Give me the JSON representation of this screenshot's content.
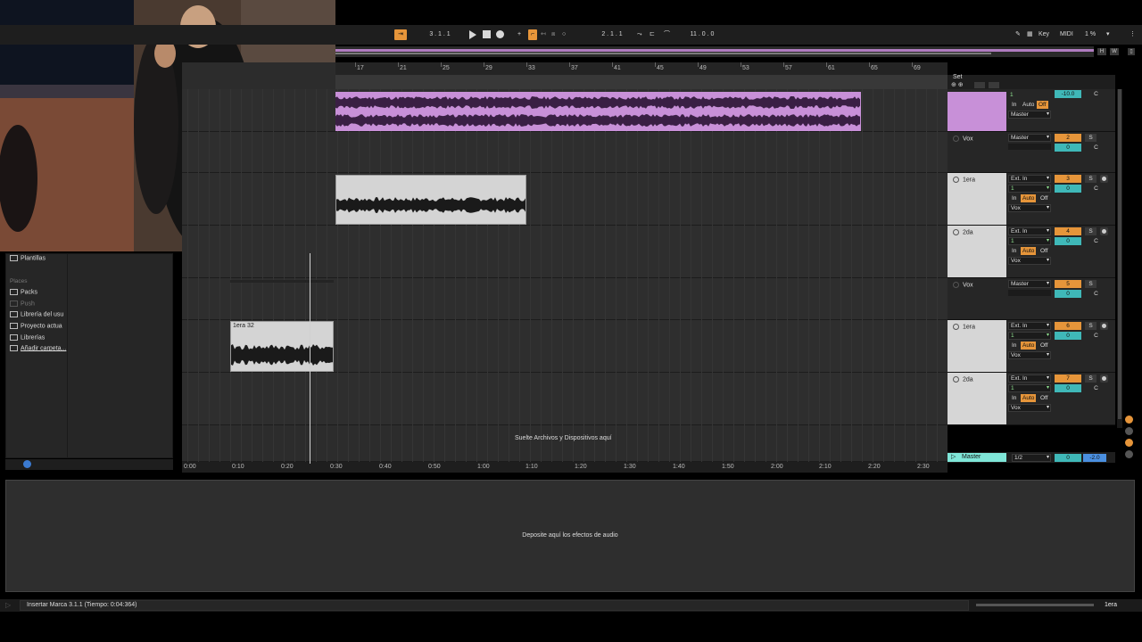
{
  "transport": {
    "arr_position": "3 .  1 .  1",
    "loop_start": "2 .  1 .  1",
    "loop_length": "11 .  0 .  0",
    "key_label": "Key",
    "midi_label": "MIDI",
    "cpu": "1 %",
    "h_label": "H",
    "w_label": "W"
  },
  "ruler": {
    "bars": [
      "17",
      "21",
      "25",
      "29",
      "33",
      "37",
      "41",
      "45",
      "49",
      "53",
      "57",
      "61",
      "65",
      "69"
    ]
  },
  "time_ruler": {
    "ticks": [
      "0:00",
      "0:10",
      "0:20",
      "0:30",
      "0:40",
      "0:50",
      "1:00",
      "1:10",
      "1:20",
      "1:30",
      "1:40",
      "1:50",
      "2:00",
      "2:10",
      "2:20",
      "2:30"
    ]
  },
  "clips": {
    "clip_small_title": "1era 32"
  },
  "drop_files_label": "Suelte Archivos y Dispositivos aquí",
  "set_label": "Set",
  "tracks": [
    {
      "name": "",
      "output": "Master",
      "sub": "1",
      "monitor": [
        "In",
        "Auto",
        "Off"
      ],
      "volume": "-10.0",
      "pan": "C"
    },
    {
      "name": "Vox",
      "output": "Master",
      "number": "2",
      "solo": "S",
      "volume": "0",
      "pan": "C"
    },
    {
      "name": "1era",
      "input": "Ext. In",
      "sub": "1",
      "monitor": [
        "In",
        "Auto",
        "Off"
      ],
      "output": "Vox",
      "number": "3",
      "solo": "S",
      "volume": "0",
      "pan": "C"
    },
    {
      "name": "2da",
      "input": "Ext. In",
      "sub": "1",
      "monitor": [
        "In",
        "Auto",
        "Off"
      ],
      "output": "Vox",
      "number": "4",
      "solo": "S",
      "volume": "0",
      "pan": "C"
    },
    {
      "name": "Vox",
      "output": "Master",
      "number": "5",
      "solo": "S",
      "volume": "0",
      "pan": "C"
    },
    {
      "name": "1era",
      "input": "Ext. In",
      "sub": "1",
      "monitor": [
        "In",
        "Auto",
        "Off"
      ],
      "output": "Vox",
      "number": "6",
      "solo": "S",
      "volume": "0",
      "pan": "C"
    },
    {
      "name": "2da",
      "input": "Ext. In",
      "sub": "1",
      "monitor": [
        "In",
        "Auto",
        "Off"
      ],
      "output": "Vox",
      "number": "7",
      "solo": "S",
      "volume": "0",
      "pan": "C"
    }
  ],
  "master": {
    "name": "Master",
    "output": "1/2",
    "volume": "0",
    "pan": "-2.0"
  },
  "browser": {
    "top_item": "Plantillas",
    "places_header": "Places",
    "places": [
      "Packs",
      "Push",
      "Librería del usu",
      "Proyecto actua",
      "Librerías",
      "Añadir carpeta..."
    ]
  },
  "device_drop_label": "Deposite aquí los efectos de audio",
  "status": {
    "message": "Insertar Marca 3.1.1 (Tiempo: 0:04:364)",
    "selected_track": "1era"
  },
  "colors": {
    "accent_orange": "#e6953a",
    "clip_purple": "#c890d8",
    "teal": "#3fb8b8",
    "master_green": "#7fe6d8"
  }
}
